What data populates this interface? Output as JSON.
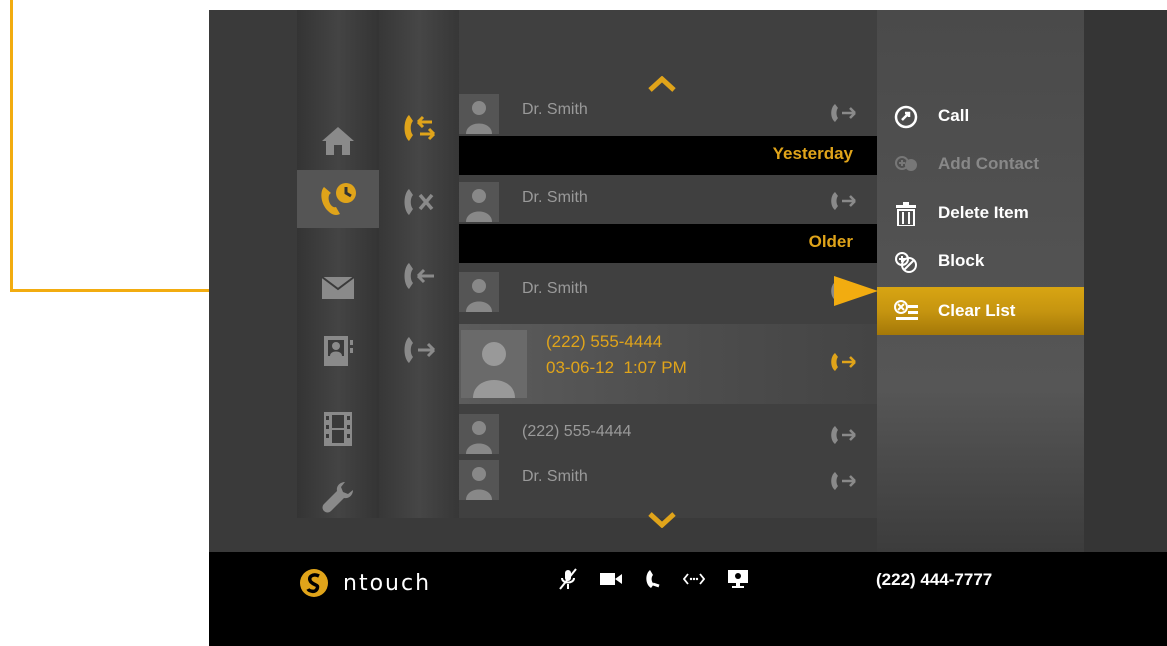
{
  "colors": {
    "accent": "#e0a41a",
    "callout": "#f2ac10",
    "background": "#3a3a3a"
  },
  "left_nav": {
    "items": [
      {
        "icon": "home-icon",
        "active": false
      },
      {
        "icon": "call-history-icon",
        "active": true
      },
      {
        "icon": "mail-icon",
        "active": false
      },
      {
        "icon": "contacts-icon",
        "active": false
      },
      {
        "icon": "video-film-icon",
        "active": false
      },
      {
        "icon": "settings-wrench-icon",
        "active": false
      }
    ]
  },
  "filters": {
    "items": [
      {
        "icon": "all-calls-icon",
        "active": true
      },
      {
        "icon": "missed-calls-icon",
        "active": false
      },
      {
        "icon": "incoming-calls-icon",
        "active": false
      },
      {
        "icon": "outgoing-calls-icon",
        "active": false
      }
    ]
  },
  "call_list": {
    "rows": [
      {
        "name": "Dr. Smith"
      },
      {
        "header": "Yesterday"
      },
      {
        "name": "Dr. Smith"
      },
      {
        "header": "Older"
      },
      {
        "name": "Dr. Smith"
      },
      {
        "selected": true,
        "number": "(222) 555-4444",
        "datetime": "03-06-12  1:07 PM"
      },
      {
        "name": "(222) 555-4444"
      },
      {
        "name": "Dr. Smith"
      }
    ]
  },
  "menu": {
    "items": [
      {
        "label": "Call",
        "icon": "call-circle-icon",
        "disabled": false,
        "selected": false
      },
      {
        "label": "Add Contact",
        "icon": "add-contact-icon",
        "disabled": true,
        "selected": false
      },
      {
        "label": "Delete Item",
        "icon": "trash-icon",
        "disabled": false,
        "selected": false
      },
      {
        "label": "Block",
        "icon": "block-icon",
        "disabled": false,
        "selected": false
      },
      {
        "label": "Clear List",
        "icon": "clear-list-icon",
        "disabled": false,
        "selected": true
      }
    ]
  },
  "status_bar": {
    "brand": "ntouch",
    "phone_number": "(222) 444-7777",
    "icons": [
      "mic-muted-icon",
      "video-camera-icon",
      "phone-icon",
      "connection-icon",
      "screen-share-icon"
    ]
  }
}
